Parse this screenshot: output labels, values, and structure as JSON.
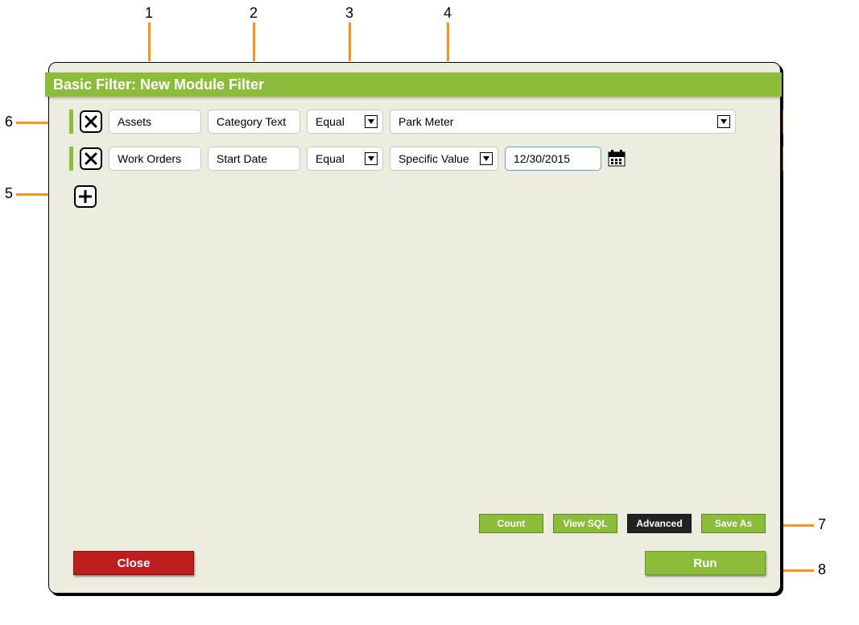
{
  "title": "Basic Filter: New Module Filter",
  "rows": [
    {
      "source": "Assets",
      "field": "Category Text",
      "op": "Equal",
      "valueType": null,
      "value": "Park Meter",
      "value_is_dropdown": true
    },
    {
      "source": "Work Orders",
      "field": "Start Date",
      "op": "Equal",
      "valueType": "Specific Value",
      "value": "12/30/2015",
      "value_is_date": true
    }
  ],
  "buttons": {
    "count": "Count",
    "view_sql": "View SQL",
    "advanced": "Advanced",
    "save_as": "Save As",
    "close": "Close",
    "run": "Run"
  },
  "callouts": {
    "c1": "1",
    "c2": "2",
    "c3": "3",
    "c4": "4",
    "c5": "5",
    "c6": "6",
    "c7": "7",
    "c8": "8"
  }
}
